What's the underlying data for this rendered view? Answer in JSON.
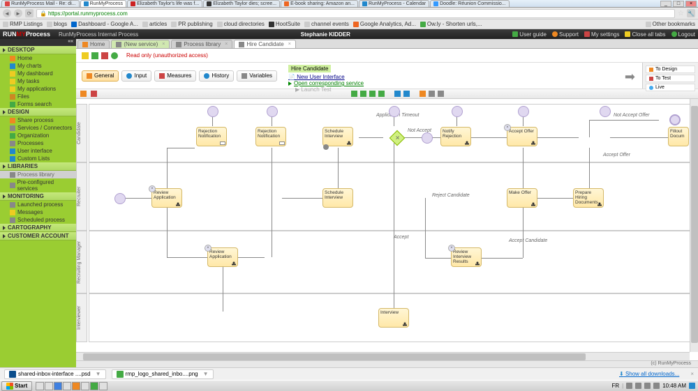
{
  "browser": {
    "tabs": [
      {
        "title": "RunMyProcess Mail - Re: di..."
      },
      {
        "title": "RunMyProcess",
        "active": true
      },
      {
        "title": "Elizabeth Taylor's life was f..."
      },
      {
        "title": "Elizabeth Taylor dies; scree..."
      },
      {
        "title": "E-book sharing: Amazon an..."
      },
      {
        "title": "RunMyProcess - Calendar"
      },
      {
        "title": "Doodle: Réunion Commissio..."
      }
    ],
    "url": "https://portal.runmyprocess.com",
    "bookmarks": [
      "RMP Listings",
      "blogs",
      "Dashboard - Google A...",
      "articles",
      "PR publishing",
      "cloud directories",
      "HootSuite",
      "channel events",
      "Google Analytics, Ad...",
      "Ow.ly - Shorten urls,..."
    ],
    "other_bookmarks": "Other bookmarks"
  },
  "header": {
    "logo_run": "RUN",
    "logo_my": "MY",
    "logo_process": "Process",
    "title": "RunMyProcess Internal Process",
    "user": "Stephanie KIDDER",
    "actions": {
      "guide": "User guide",
      "support": "Support",
      "settings": "My settings",
      "close_tabs": "Close all tabs",
      "logout": "Logout"
    }
  },
  "sidebar": {
    "desktop": {
      "label": "DESKTOP",
      "items": [
        "Home",
        "My charts",
        "My dashboard",
        "My tasks",
        "My applications",
        "Files",
        "Forms search"
      ]
    },
    "design": {
      "label": "DESIGN",
      "items": [
        "Share process",
        "Services / Connectors",
        "Organization",
        "Processes",
        "User interface",
        "Custom Lists"
      ]
    },
    "libraries": {
      "label": "LIBRARIES",
      "items": [
        "Process library",
        "Pre-configured services"
      ]
    },
    "monitoring": {
      "label": "MONITORING",
      "items": [
        "Launched process",
        "Messages",
        "Scheduled process"
      ]
    },
    "cartography": {
      "label": "CARTOGRAPHY"
    },
    "customer": {
      "label": "CUSTOMER ACCOUNT"
    }
  },
  "tabs": [
    "Home",
    "(New service)",
    "Process library",
    "Hire Candidate"
  ],
  "toolbar": {
    "readonly": "Read only (unauthorized access)",
    "general": "General",
    "input": "Input",
    "measures": "Measures",
    "history": "History",
    "variables": "Variables"
  },
  "meta": {
    "hire": "Hire Candidate",
    "new_ui": "New User Interface",
    "open_service": "Open corresponding service",
    "launch": "Launch Test"
  },
  "right_actions": {
    "design": "To Design",
    "test": "To Test",
    "live": "Live"
  },
  "lanes": [
    "Candidate",
    "Recruiter",
    "Recruiting Manager",
    "Interviewer"
  ],
  "tasks": {
    "rejection_notif1": "Rejection Notification",
    "rejection_notif2": "Rejection Notification",
    "schedule_interview1": "Schedule Interview",
    "notify_rejection": "Notify Rejection",
    "accept_offer": "Accept Offer",
    "fillout": "Fillout Docum",
    "review_app1": "Review Application",
    "schedule_interview2": "Schedule Interview",
    "make_offer": "Make Offer",
    "prepare_hiring": "Prepare Hiring Documents",
    "review_app2": "Review Application",
    "review_results": "Review Interview Results",
    "interview": "Interview"
  },
  "flow_labels": {
    "app_timeout": "Application Timeout",
    "not_accept": "Not Accept",
    "not_accept_offer": "Not Accept Offer",
    "accept_offer": "Accept Offer",
    "reject_candidate": "Reject Candidate",
    "accept": "Accept",
    "accept_candidate": "Accept Candidate"
  },
  "footer": "(c) RunMyProcess",
  "downloads": {
    "item1": "shared-inbox-interface ....psd",
    "item2": "rmp_logo_shared_inbo....png",
    "show_all": "Show all downloads..."
  },
  "taskbar": {
    "start": "Start",
    "lang": "FR",
    "time": "10:48 AM"
  }
}
